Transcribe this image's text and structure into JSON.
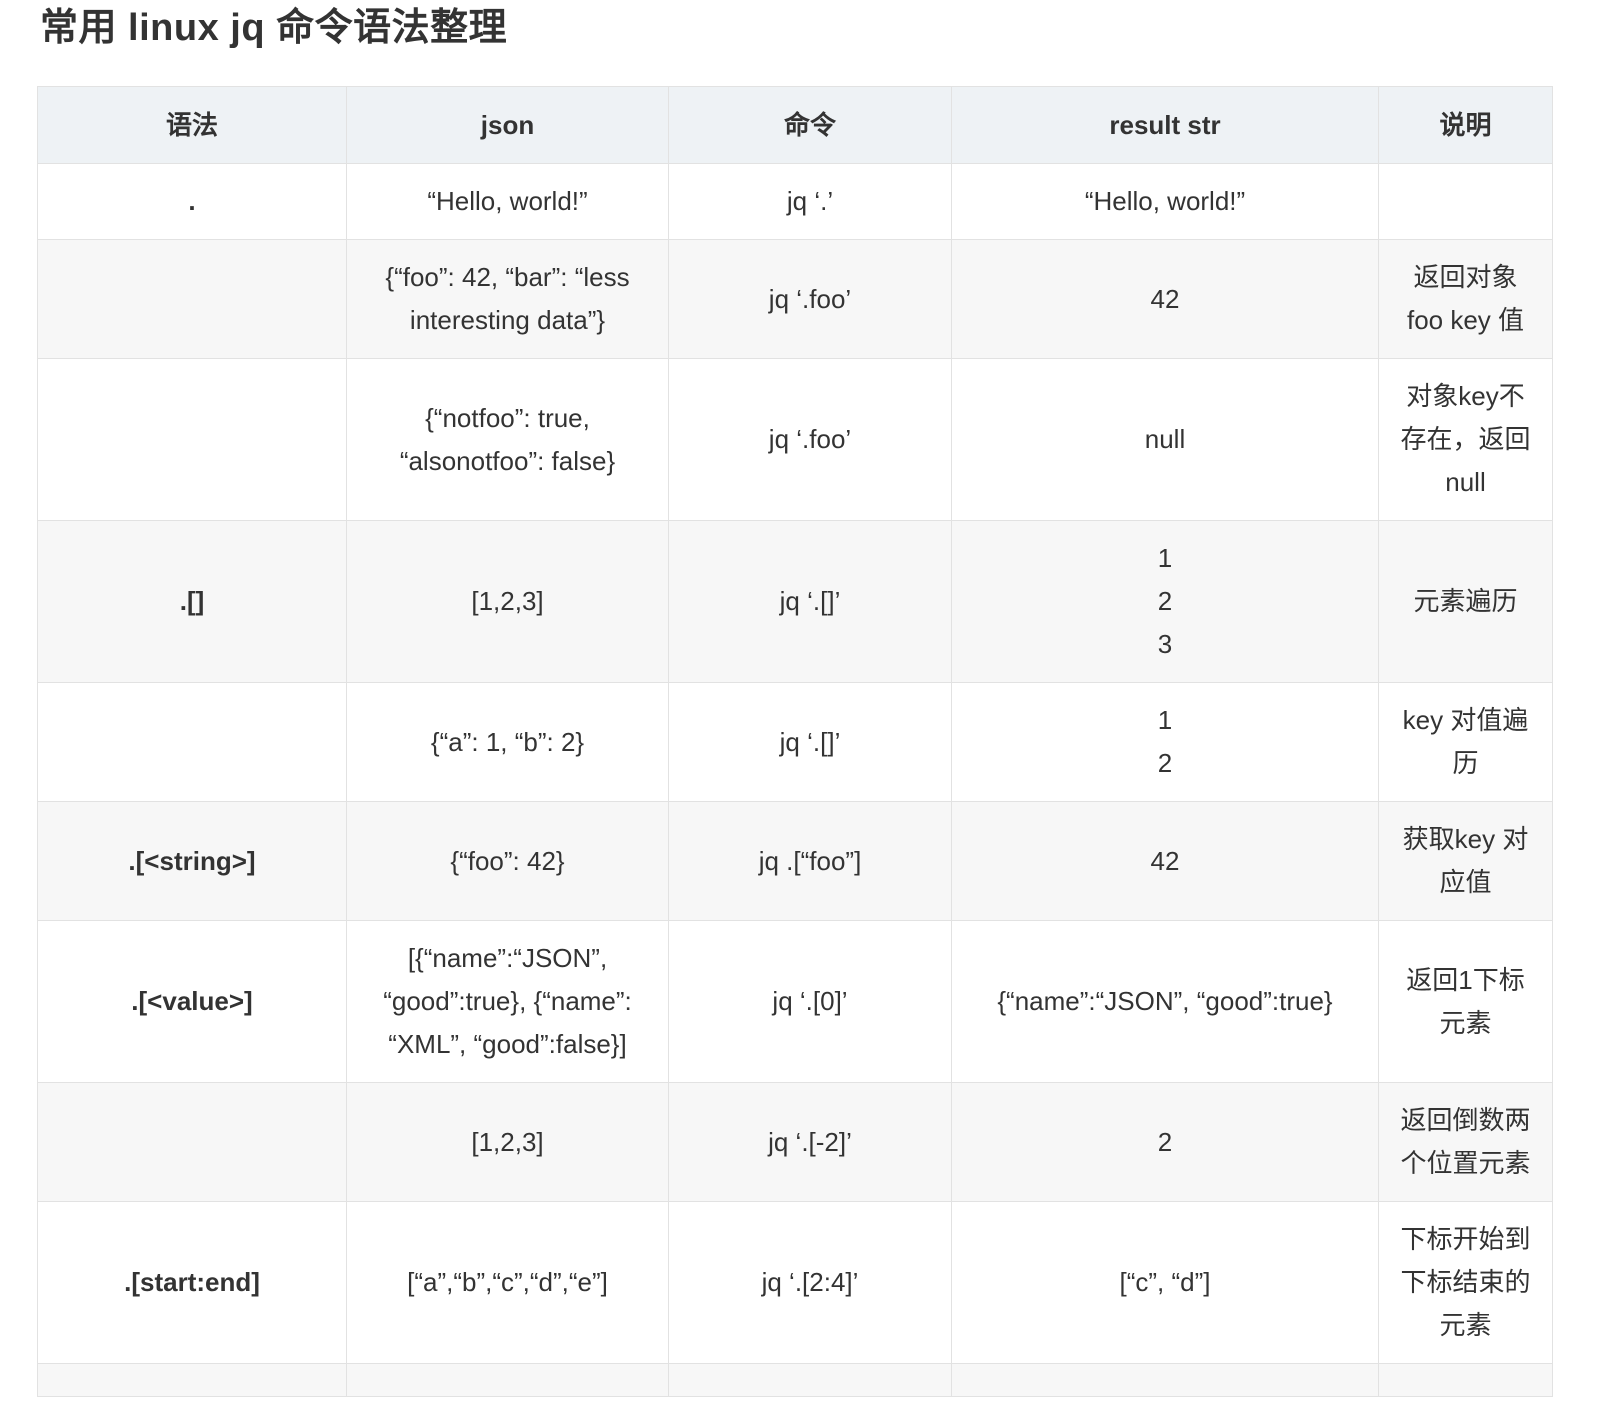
{
  "title": "常用 linux jq 命令语法整理",
  "table": {
    "headers": [
      "语法",
      "json",
      "命令",
      "result str",
      "说明"
    ],
    "rows": [
      {
        "syntax": ".",
        "json": "“Hello, world!”",
        "command": "jq ‘.’",
        "result": [
          "“Hello, world!”"
        ],
        "note": ""
      },
      {
        "syntax": "",
        "json": "{“foo”: 42, “bar”: “less interesting data”}",
        "command": "jq ‘.foo’",
        "result": [
          "42"
        ],
        "note": "返回对象 foo key 值"
      },
      {
        "syntax": "",
        "json": "{“notfoo”: true, “alsonotfoo”: false}",
        "command": "jq ‘.foo’",
        "result": [
          "null"
        ],
        "note": "对象key不存在，返回null"
      },
      {
        "syntax": ".[]",
        "json": "[1,2,3]",
        "command": "jq ‘.[]’",
        "result": [
          "1",
          "2",
          "3"
        ],
        "note": "元素遍历"
      },
      {
        "syntax": "",
        "json": "{“a”: 1, “b”: 2}",
        "command": "jq ‘.[]’",
        "result": [
          "1",
          "2"
        ],
        "note": "key 对值遍历"
      },
      {
        "syntax": ".[<string>]",
        "json": "{“foo”: 42}",
        "command": "jq .[“foo”]",
        "result": [
          "42"
        ],
        "note": "获取key 对应值"
      },
      {
        "syntax": ".[<value>]",
        "json": "[{“name”:“JSON”, “good”:true}, {“name”: “XML”, “good”:false}]",
        "command": "jq ‘.[0]’",
        "result": [
          "{“name”:“JSON”, “good”:true}"
        ],
        "note": "返回1下标元素"
      },
      {
        "syntax": "",
        "json": "[1,2,3]",
        "command": "jq ‘.[-2]’",
        "result": [
          "2"
        ],
        "note": "返回倒数两个位置元素"
      },
      {
        "syntax": ".[start:end]",
        "json": "[“a”,“b”,“c”,“d”,“e”]",
        "command": "jq ‘.[2:4]’",
        "result": [
          "[“c”, “d”]"
        ],
        "note": "下标开始到下标结束的元素"
      },
      {
        "syntax": "",
        "json": "",
        "command": "",
        "result": [
          ""
        ],
        "note": ""
      }
    ]
  }
}
